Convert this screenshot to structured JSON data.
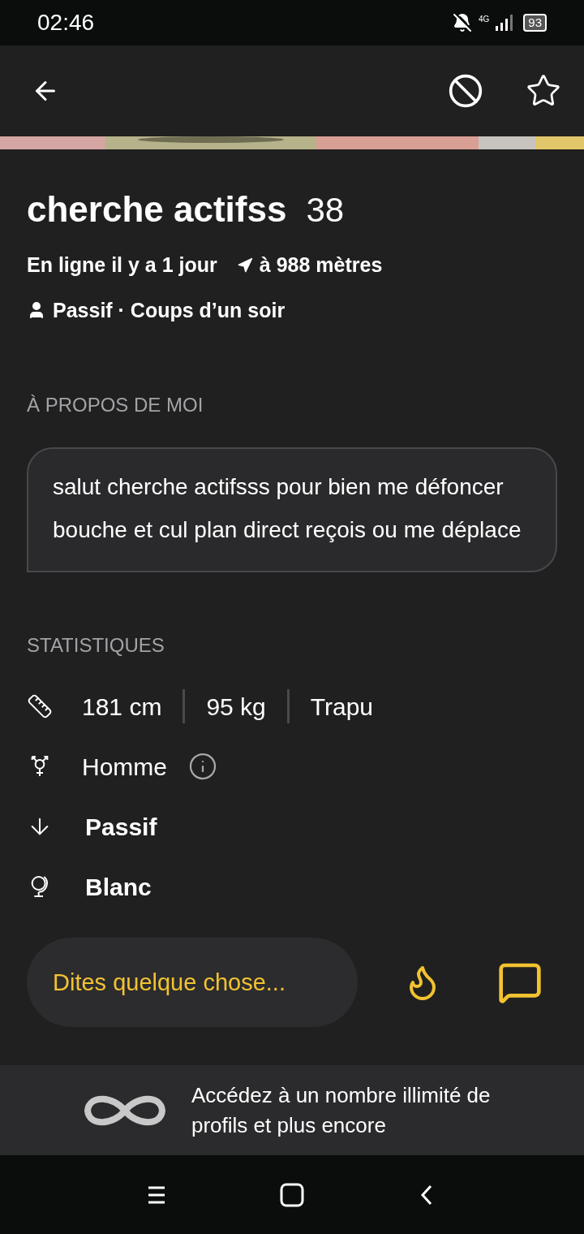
{
  "status_bar": {
    "time": "02:46",
    "network": "4G",
    "battery": "93"
  },
  "profile": {
    "name": "cherche actifss",
    "age": "38",
    "online": "En ligne il y a 1 jour",
    "distance": "à 988 mètres",
    "tags": "Passif · Coups d’un soir"
  },
  "about": {
    "heading": "À PROPOS DE MOI",
    "text": "salut cherche actifsss pour bien me défoncer bouche et cul plan direct reçois ou me déplace"
  },
  "stats": {
    "heading": "STATISTIQUES",
    "rows": [
      {
        "kind": "measures",
        "values": [
          "181 cm",
          "95 kg",
          "Trapu"
        ]
      },
      {
        "kind": "gender",
        "values": [
          "Homme"
        ]
      },
      {
        "kind": "position",
        "values": [
          "Passif"
        ]
      },
      {
        "kind": "ethnicity",
        "values": [
          "Blanc"
        ]
      }
    ]
  },
  "composer": {
    "placeholder": "Dites quelque chose..."
  },
  "promo": {
    "text": "Accédez à un nombre illimité de profils et plus encore"
  }
}
